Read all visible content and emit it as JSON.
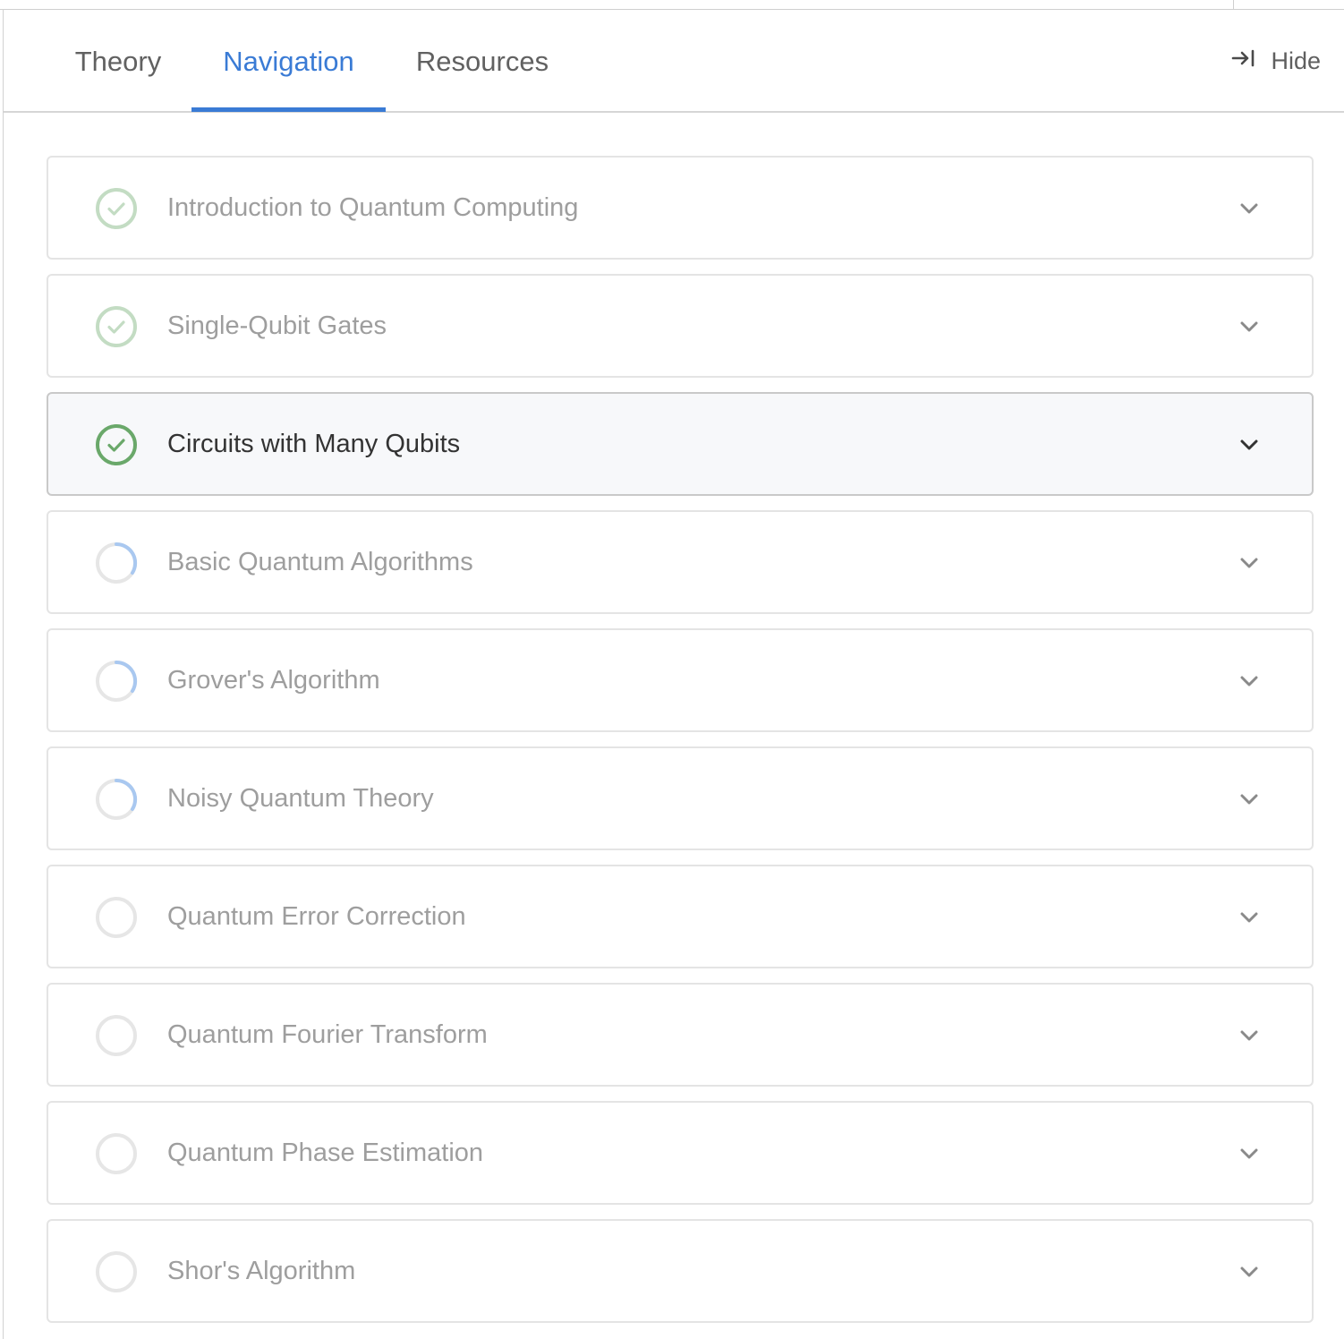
{
  "tabs": [
    {
      "label": "Theory",
      "active": false
    },
    {
      "label": "Navigation",
      "active": true
    },
    {
      "label": "Resources",
      "active": false
    }
  ],
  "hide_button": {
    "label": "Hide",
    "icon": "collapse-right-icon"
  },
  "colors": {
    "accent": "#3a7bd5",
    "complete": "#6aa86a",
    "complete_faded": "#c3dcc3",
    "progress": "#a9c8f0",
    "ring": "#e6e6e6"
  },
  "modules": [
    {
      "title": "Introduction to Quantum Computing",
      "status": "complete",
      "active": false
    },
    {
      "title": "Single-Qubit Gates",
      "status": "complete",
      "active": false
    },
    {
      "title": "Circuits with Many Qubits",
      "status": "complete",
      "active": true
    },
    {
      "title": "Basic Quantum Algorithms",
      "status": "in-progress",
      "active": false
    },
    {
      "title": "Grover's Algorithm",
      "status": "in-progress",
      "active": false
    },
    {
      "title": "Noisy Quantum Theory",
      "status": "in-progress",
      "active": false
    },
    {
      "title": "Quantum Error Correction",
      "status": "not-started",
      "active": false
    },
    {
      "title": "Quantum Fourier Transform",
      "status": "not-started",
      "active": false
    },
    {
      "title": "Quantum Phase Estimation",
      "status": "not-started",
      "active": false
    },
    {
      "title": "Shor's Algorithm",
      "status": "not-started",
      "active": false
    }
  ]
}
